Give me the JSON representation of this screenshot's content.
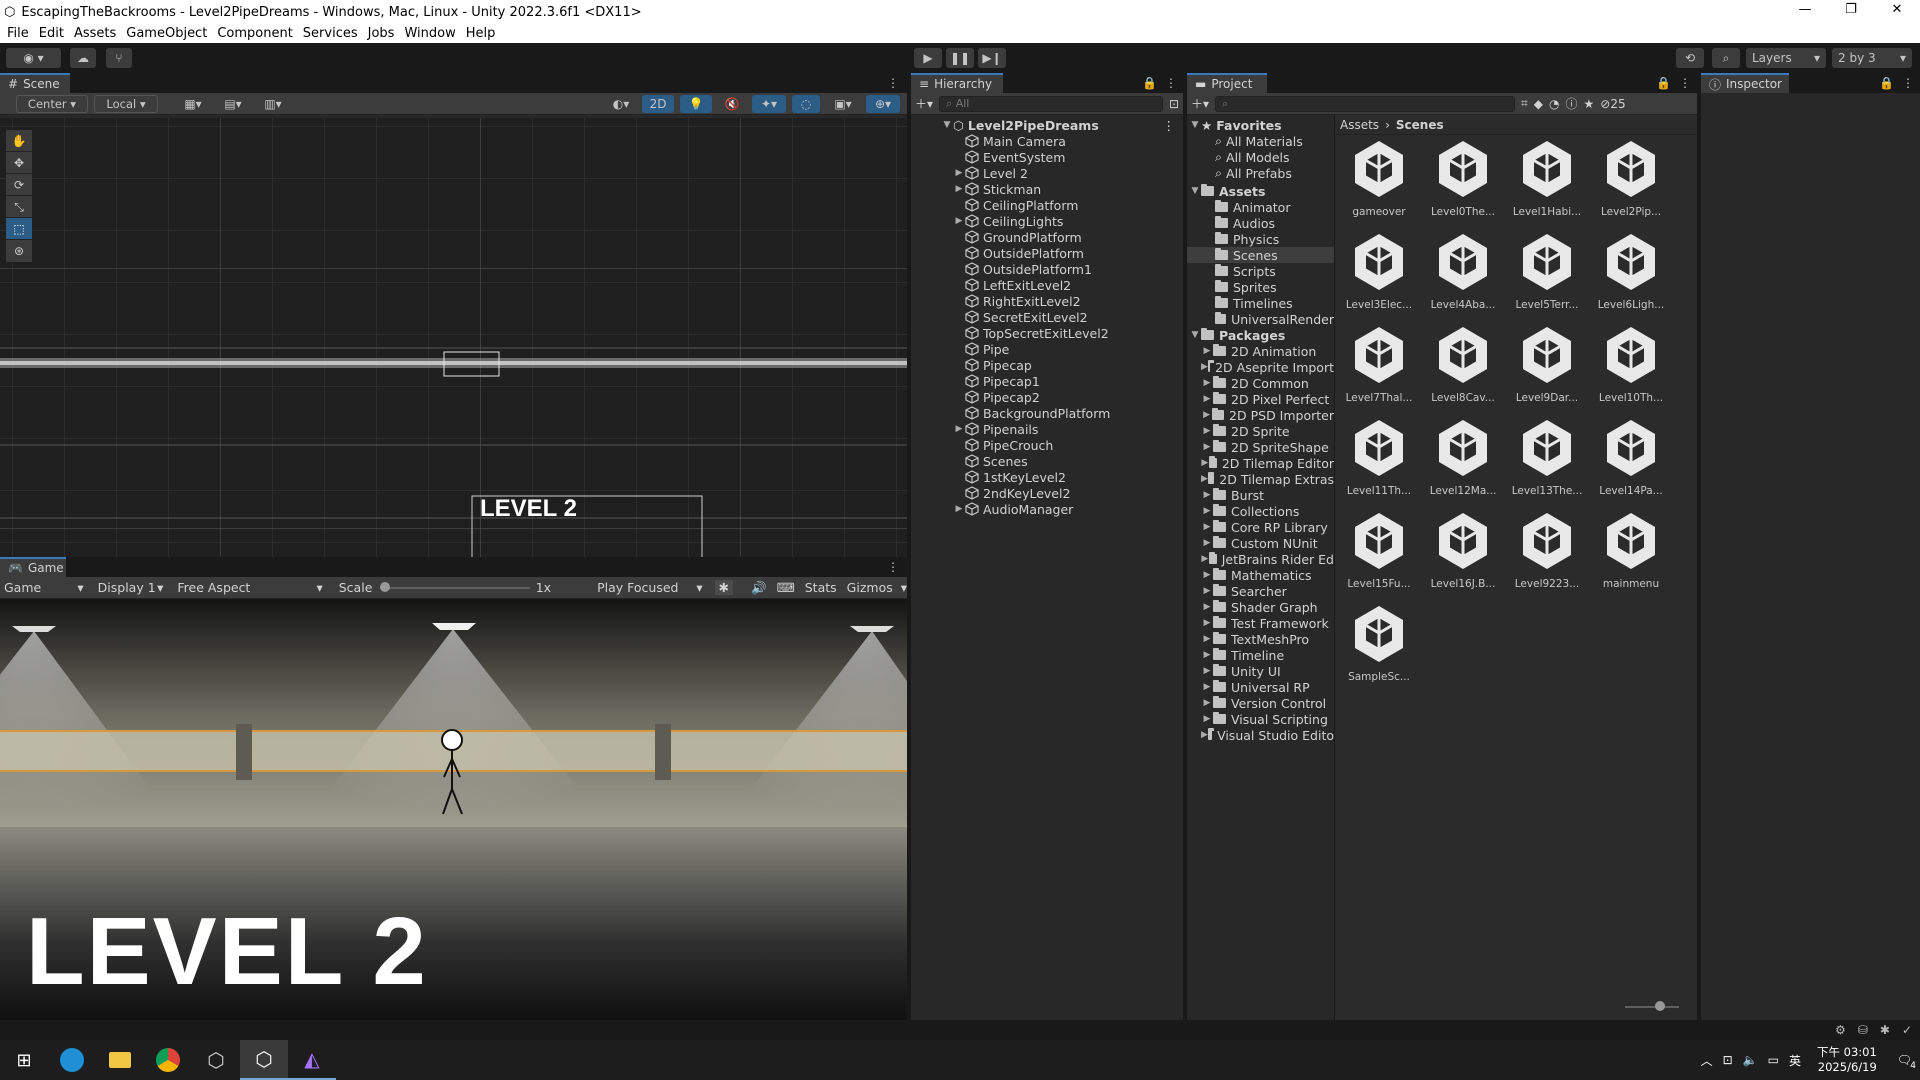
{
  "window": {
    "title": "EscapingTheBackrooms - Level2PipeDreams - Windows, Mac, Linux - Unity 2022.3.6f1 <DX11>"
  },
  "menu": [
    "File",
    "Edit",
    "Assets",
    "GameObject",
    "Component",
    "Services",
    "Jobs",
    "Window",
    "Help"
  ],
  "toolbar": {
    "layers": "Layers",
    "layout": "2 by 3"
  },
  "scene": {
    "tab": "Scene",
    "pivot": "Center",
    "space": "Local",
    "mode_2d": "2D",
    "level_text": "LEVEL 2"
  },
  "game": {
    "tab": "Game",
    "view": "Game",
    "display": "Display 1",
    "aspect": "Free Aspect",
    "scale_label": "Scale",
    "scale_value": "1x",
    "play_mode": "Play Focused",
    "stats": "Stats",
    "gizmos": "Gizmos",
    "level_text": "LEVEL 2"
  },
  "hierarchy": {
    "tab": "Hierarchy",
    "search_placeholder": "All",
    "root": "Level2PipeDreams",
    "items": [
      {
        "label": "Main Camera",
        "expandable": false
      },
      {
        "label": "EventSystem",
        "expandable": false
      },
      {
        "label": "Level 2",
        "expandable": true
      },
      {
        "label": "Stickman",
        "expandable": true
      },
      {
        "label": "CeilingPlatform",
        "expandable": false
      },
      {
        "label": "CeilingLights",
        "expandable": true
      },
      {
        "label": "GroundPlatform",
        "expandable": false
      },
      {
        "label": "OutsidePlatform",
        "expandable": false
      },
      {
        "label": "OutsidePlatform1",
        "expandable": false
      },
      {
        "label": "LeftExitLevel2",
        "expandable": false
      },
      {
        "label": "RightExitLevel2",
        "expandable": false
      },
      {
        "label": "SecretExitLevel2",
        "expandable": false
      },
      {
        "label": "TopSecretExitLevel2",
        "expandable": false
      },
      {
        "label": "Pipe",
        "expandable": false
      },
      {
        "label": "Pipecap",
        "expandable": false
      },
      {
        "label": "Pipecap1",
        "expandable": false
      },
      {
        "label": "Pipecap2",
        "expandable": false
      },
      {
        "label": "BackgroundPlatform",
        "expandable": false
      },
      {
        "label": "Pipenails",
        "expandable": true
      },
      {
        "label": "PipeCrouch",
        "expandable": false
      },
      {
        "label": "Scenes",
        "expandable": false
      },
      {
        "label": "1stKeyLevel2",
        "expandable": false
      },
      {
        "label": "2ndKeyLevel2",
        "expandable": false
      },
      {
        "label": "AudioManager",
        "expandable": true
      }
    ]
  },
  "project": {
    "tab": "Project",
    "hidden_count": "25",
    "favorites_label": "Favorites",
    "favorites": [
      "All Materials",
      "All Models",
      "All Prefabs"
    ],
    "assets_label": "Assets",
    "assets": [
      "Animator",
      "Audios",
      "Physics",
      "Scenes",
      "Scripts",
      "Sprites",
      "Timelines",
      "UniversalRender"
    ],
    "packages_label": "Packages",
    "packages": [
      "2D Animation",
      "2D Aseprite Import",
      "2D Common",
      "2D Pixel Perfect",
      "2D PSD Importer",
      "2D Sprite",
      "2D SpriteShape",
      "2D Tilemap Editor",
      "2D Tilemap Extras",
      "Burst",
      "Collections",
      "Core RP Library",
      "Custom NUnit",
      "JetBrains Rider Ed",
      "Mathematics",
      "Searcher",
      "Shader Graph",
      "Test Framework",
      "TextMeshPro",
      "Timeline",
      "Unity UI",
      "Universal RP",
      "Version Control",
      "Visual Scripting",
      "Visual Studio Edito"
    ],
    "breadcrumb": [
      "Assets",
      "Scenes"
    ],
    "scene_files": [
      "gameover",
      "Level0The...",
      "Level1Habi...",
      "Level2Pip...",
      "Level3Elec...",
      "Level4Aba...",
      "Level5Terr...",
      "Level6Ligh...",
      "Level7Thal...",
      "Level8Cav...",
      "Level9Dar...",
      "Level10Th...",
      "Level11Th...",
      "Level12Ma...",
      "Level13The...",
      "Level14Pa...",
      "Level15Fu...",
      "Level16J.B...",
      "Level9223...",
      "mainmenu",
      "SampleSc..."
    ]
  },
  "inspector": {
    "tab": "Inspector"
  },
  "taskbar": {
    "time": "下午 03:01",
    "date": "2025/6/19",
    "ime": "英",
    "notifications": "4"
  },
  "colors": {
    "accent": "#3a79bb",
    "selected": "#2c5d87",
    "panel": "#282828",
    "toolbar": "#191919"
  }
}
